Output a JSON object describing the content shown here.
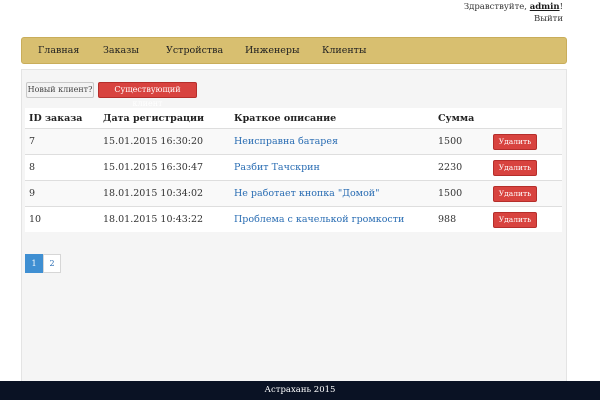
{
  "header": {
    "greeting": "Здравствуйте,",
    "username": "admin",
    "greeting_suffix": "!",
    "logout": "Выйти"
  },
  "nav": {
    "items": [
      {
        "label": "Главная"
      },
      {
        "label": "Заказы"
      },
      {
        "label": "Устройства"
      },
      {
        "label": "Инженеры"
      },
      {
        "label": "Клиенты"
      }
    ]
  },
  "client_toggle": {
    "new_client": "Новый клиент?",
    "existing_client": "Существующий клиент"
  },
  "table": {
    "columns": [
      "ID заказа",
      "Дата регистрации",
      "Краткое описание",
      "Сумма"
    ],
    "rows": [
      {
        "id": "7",
        "date": "15.01.2015 16:30:20",
        "description": "Неисправна батарея",
        "sum": "1500",
        "action": "Удалить"
      },
      {
        "id": "8",
        "date": "15.01.2015 16:30:47",
        "description": "Разбит Тачскрин",
        "sum": "2230",
        "action": "Удалить"
      },
      {
        "id": "9",
        "date": "18.01.2015 10:34:02",
        "description": "Не работает кнопка \"Домой\"",
        "sum": "1500",
        "action": "Удалить"
      },
      {
        "id": "10",
        "date": "18.01.2015 10:43:22",
        "description": "Проблема с качелькой громкости",
        "sum": "988",
        "action": "Удалить"
      }
    ]
  },
  "pagination": {
    "pages": [
      "1",
      "2"
    ],
    "current": "1"
  },
  "footer": {
    "text": "Астрахань 2015"
  },
  "colors": {
    "navbar": "#d8bf70",
    "danger": "#d8433f",
    "link": "#2a6db3",
    "active_page": "#3f8fd2",
    "footer": "#0a1224"
  }
}
